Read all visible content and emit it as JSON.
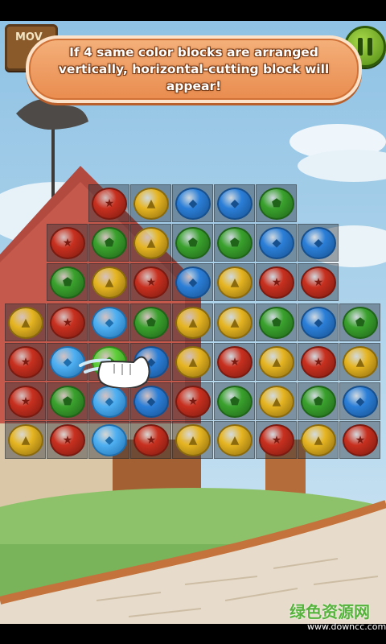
{
  "hud": {
    "moves_label": "MOV",
    "pause_icon": "pause-icon"
  },
  "tutorial": {
    "message": "If 4 same color blocks are arranged vertically, horizontal-cutting block will appear!"
  },
  "colors": {
    "red": "#c8301f",
    "yellow": "#e6b522",
    "blue": "#2b7fd8",
    "green": "#3aa12d",
    "lightblue": "#4fb0f2"
  },
  "board": {
    "rows": [
      [
        "",
        "",
        "red",
        "yellow",
        "blue",
        "blue",
        "green",
        "",
        ""
      ],
      [
        "",
        "red",
        "green",
        "yellow",
        "green",
        "green",
        "blue",
        "blue",
        ""
      ],
      [
        "",
        "green",
        "yellow",
        "red",
        "blue",
        "yellow",
        "red",
        "red",
        ""
      ],
      [
        "yellow",
        "red",
        "lightblue",
        "green",
        "yellow",
        "yellow",
        "green",
        "blue",
        "green"
      ],
      [
        "red",
        "lightblue",
        "lightgreen",
        "blue",
        "yellow",
        "red",
        "yellow",
        "red",
        "yellow"
      ],
      [
        "red",
        "green",
        "lightblue",
        "blue",
        "red",
        "green",
        "yellow",
        "green",
        "blue"
      ],
      [
        "yellow",
        "red",
        "lightblue",
        "red",
        "yellow",
        "yellow",
        "red",
        "yellow",
        "red"
      ]
    ],
    "symbols": {
      "red": "★",
      "yellow": "▲",
      "blue": "◆",
      "green": "⬟",
      "lightblue": "◆",
      "lightgreen": "⬟"
    }
  },
  "watermark": {
    "brand": "绿色资源网",
    "url": "www.downcc.com"
  }
}
